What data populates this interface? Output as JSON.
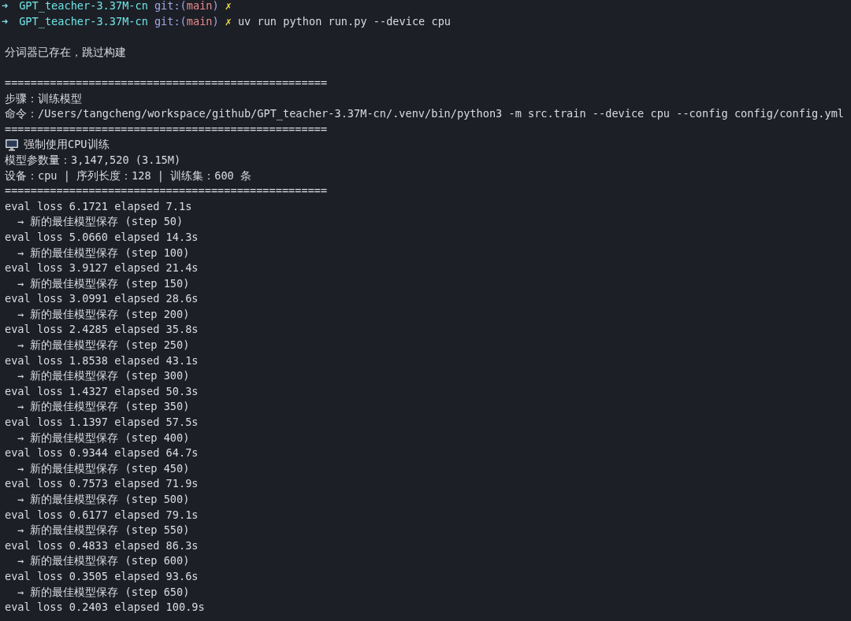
{
  "lines": [
    {
      "kind": "prompt",
      "arrow": "➜",
      "dir": "GPT_teacher-3.37M-cn",
      "git_open": "git:(",
      "branch": "main",
      "git_close": ")",
      "dirty": "✗"
    },
    {
      "kind": "prompt",
      "arrow": "➜",
      "dir": "GPT_teacher-3.37M-cn",
      "git_open": "git:(",
      "branch": "main",
      "git_close": ")",
      "dirty": "✗",
      "command": "uv run python run.py --device cpu"
    },
    {
      "kind": "gap"
    },
    {
      "kind": "text",
      "text": "分词器已存在，跳过构建"
    },
    {
      "kind": "gap"
    },
    {
      "kind": "text",
      "text": "=================================================="
    },
    {
      "kind": "text",
      "text": "步骤：训练模型"
    },
    {
      "kind": "text",
      "text": "命令：/Users/tangcheng/workspace/github/GPT_teacher-3.37M-cn/.venv/bin/python3 -m src.train --device cpu --config config/config.yml"
    },
    {
      "kind": "text",
      "text": "=================================================="
    },
    {
      "kind": "icon_text",
      "text": "强制使用CPU训练"
    },
    {
      "kind": "text",
      "text": "模型参数量：3,147,520 (3.15M)"
    },
    {
      "kind": "text",
      "text": "设备：cpu | 序列长度：128 | 训练集：600 条"
    },
    {
      "kind": "text",
      "text": "=================================================="
    },
    {
      "kind": "text",
      "text": "eval loss 6.1721 elapsed 7.1s"
    },
    {
      "kind": "save",
      "text": "→ 新的最佳模型保存 (step 50)"
    },
    {
      "kind": "text",
      "text": "eval loss 5.0660 elapsed 14.3s"
    },
    {
      "kind": "save",
      "text": "→ 新的最佳模型保存 (step 100)"
    },
    {
      "kind": "text",
      "text": "eval loss 3.9127 elapsed 21.4s"
    },
    {
      "kind": "save",
      "text": "→ 新的最佳模型保存 (step 150)"
    },
    {
      "kind": "text",
      "text": "eval loss 3.0991 elapsed 28.6s"
    },
    {
      "kind": "save",
      "text": "→ 新的最佳模型保存 (step 200)"
    },
    {
      "kind": "text",
      "text": "eval loss 2.4285 elapsed 35.8s"
    },
    {
      "kind": "save",
      "text": "→ 新的最佳模型保存 (step 250)"
    },
    {
      "kind": "text",
      "text": "eval loss 1.8538 elapsed 43.1s"
    },
    {
      "kind": "save",
      "text": "→ 新的最佳模型保存 (step 300)"
    },
    {
      "kind": "text",
      "text": "eval loss 1.4327 elapsed 50.3s"
    },
    {
      "kind": "save",
      "text": "→ 新的最佳模型保存 (step 350)"
    },
    {
      "kind": "text",
      "text": "eval loss 1.1397 elapsed 57.5s"
    },
    {
      "kind": "save",
      "text": "→ 新的最佳模型保存 (step 400)"
    },
    {
      "kind": "text",
      "text": "eval loss 0.9344 elapsed 64.7s"
    },
    {
      "kind": "save",
      "text": "→ 新的最佳模型保存 (step 450)"
    },
    {
      "kind": "text",
      "text": "eval loss 0.7573 elapsed 71.9s"
    },
    {
      "kind": "save",
      "text": "→ 新的最佳模型保存 (step 500)"
    },
    {
      "kind": "text",
      "text": "eval loss 0.6177 elapsed 79.1s"
    },
    {
      "kind": "save",
      "text": "→ 新的最佳模型保存 (step 550)"
    },
    {
      "kind": "text",
      "text": "eval loss 0.4833 elapsed 86.3s"
    },
    {
      "kind": "save",
      "text": "→ 新的最佳模型保存 (step 600)"
    },
    {
      "kind": "text",
      "text": "eval loss 0.3505 elapsed 93.6s"
    },
    {
      "kind": "save",
      "text": "→ 新的最佳模型保存 (step 650)"
    },
    {
      "kind": "text",
      "text": "eval loss 0.2403 elapsed 100.9s"
    }
  ]
}
